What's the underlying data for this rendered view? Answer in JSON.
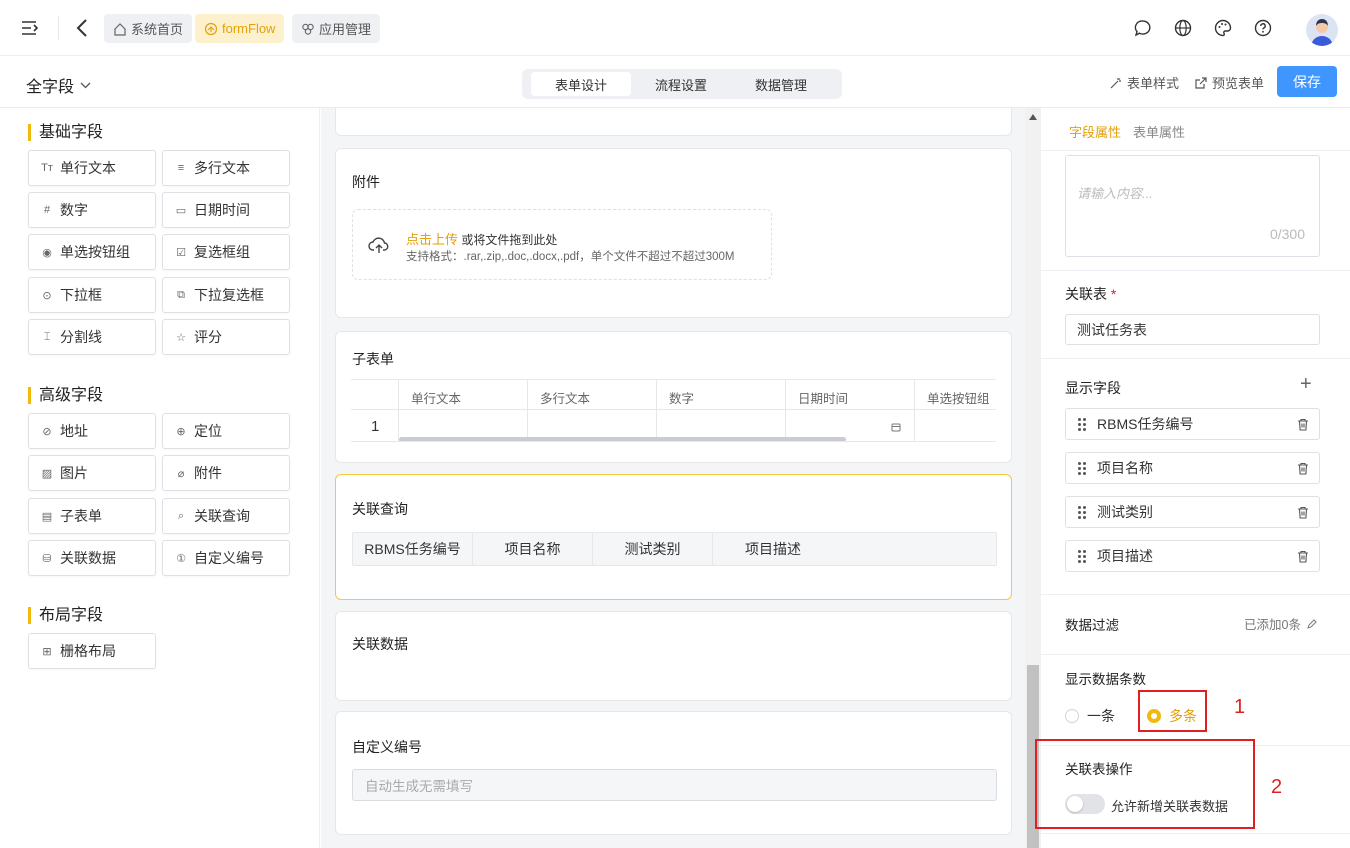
{
  "topbar": {
    "crumbs": [
      {
        "label": "系统首页",
        "icon": "home-icon"
      },
      {
        "label": "formFlow",
        "icon": "flow-icon"
      },
      {
        "label": "应用管理",
        "icon": "apps-icon"
      }
    ],
    "icons": [
      "menu-fold-icon",
      "back-arrow-icon",
      "message-icon",
      "globe-icon",
      "palette-icon",
      "help-icon"
    ]
  },
  "header": {
    "form_title": "全字段",
    "tabs": [
      "表单设计",
      "流程设置",
      "数据管理"
    ],
    "active_tab": "表单设计",
    "form_style": "表单样式",
    "preview": "预览表单",
    "save": "保存"
  },
  "palette": {
    "groups": [
      {
        "title": "基础字段",
        "items": [
          {
            "label": "单行文本",
            "icon": "Tт"
          },
          {
            "label": "多行文本",
            "icon": "≡"
          },
          {
            "label": "数字",
            "icon": "#"
          },
          {
            "label": "日期时间",
            "icon": "▭"
          },
          {
            "label": "单选按钮组",
            "icon": "◉"
          },
          {
            "label": "复选框组",
            "icon": "☑"
          },
          {
            "label": "下拉框",
            "icon": "⊙"
          },
          {
            "label": "下拉复选框",
            "icon": "⧉"
          },
          {
            "label": "分割线",
            "icon": "⌶"
          },
          {
            "label": "评分",
            "icon": "☆"
          }
        ]
      },
      {
        "title": "高级字段",
        "items": [
          {
            "label": "地址",
            "icon": "⊘"
          },
          {
            "label": "定位",
            "icon": "⊕"
          },
          {
            "label": "图片",
            "icon": "▨"
          },
          {
            "label": "附件",
            "icon": "⌀"
          },
          {
            "label": "子表单",
            "icon": "▤"
          },
          {
            "label": "关联查询",
            "icon": "⌕"
          },
          {
            "label": "关联数据",
            "icon": "⛁"
          },
          {
            "label": "自定义编号",
            "icon": "①"
          }
        ]
      },
      {
        "title": "布局字段",
        "items": [
          {
            "label": "栅格布局",
            "icon": "⊞"
          }
        ]
      }
    ]
  },
  "canvas": {
    "attachment": {
      "title": "附件",
      "upload_link": "点击上传",
      "upload_text": "或将文件拖到此处",
      "upload_hint": "支持格式：.rar,.zip,.doc,.docx,.pdf，单个文件不超过不超过300M"
    },
    "subform": {
      "title": "子表单",
      "columns": [
        "单行文本",
        "多行文本",
        "数字",
        "日期时间",
        "单选按钮组"
      ],
      "row_index": "1"
    },
    "relation_query": {
      "title": "关联查询",
      "columns": [
        "RBMS任务编号",
        "项目名称",
        "测试类别",
        "项目描述"
      ]
    },
    "relation_data": {
      "title": "关联数据"
    },
    "custom_number": {
      "title": "自定义编号",
      "placeholder": "自动生成无需填写"
    }
  },
  "properties": {
    "tabs": [
      "字段属性",
      "表单属性"
    ],
    "active_tab": "字段属性",
    "textarea": {
      "placeholder": "请输入内容...",
      "counter": "0/300"
    },
    "relation_table": {
      "label": "关联表",
      "required_mark": "*",
      "value": "测试任务表"
    },
    "display_fields": {
      "label": "显示字段",
      "add": "+",
      "items": [
        "RBMS任务编号",
        "项目名称",
        "测试类别",
        "项目描述"
      ]
    },
    "data_filter": {
      "label": "数据过滤",
      "value": "已添加0条"
    },
    "display_count": {
      "label": "显示数据条数",
      "options": [
        "一条",
        "多条"
      ],
      "selected": "多条"
    },
    "relation_ops": {
      "label": "关联表操作",
      "toggle_label": "允许新增关联表数据",
      "enabled": false
    }
  },
  "annotations": [
    {
      "label": "1"
    },
    {
      "label": "2"
    }
  ],
  "colors": {
    "accent": "#f0b90b",
    "primary": "#4096ff",
    "annotation": "#e02020"
  }
}
